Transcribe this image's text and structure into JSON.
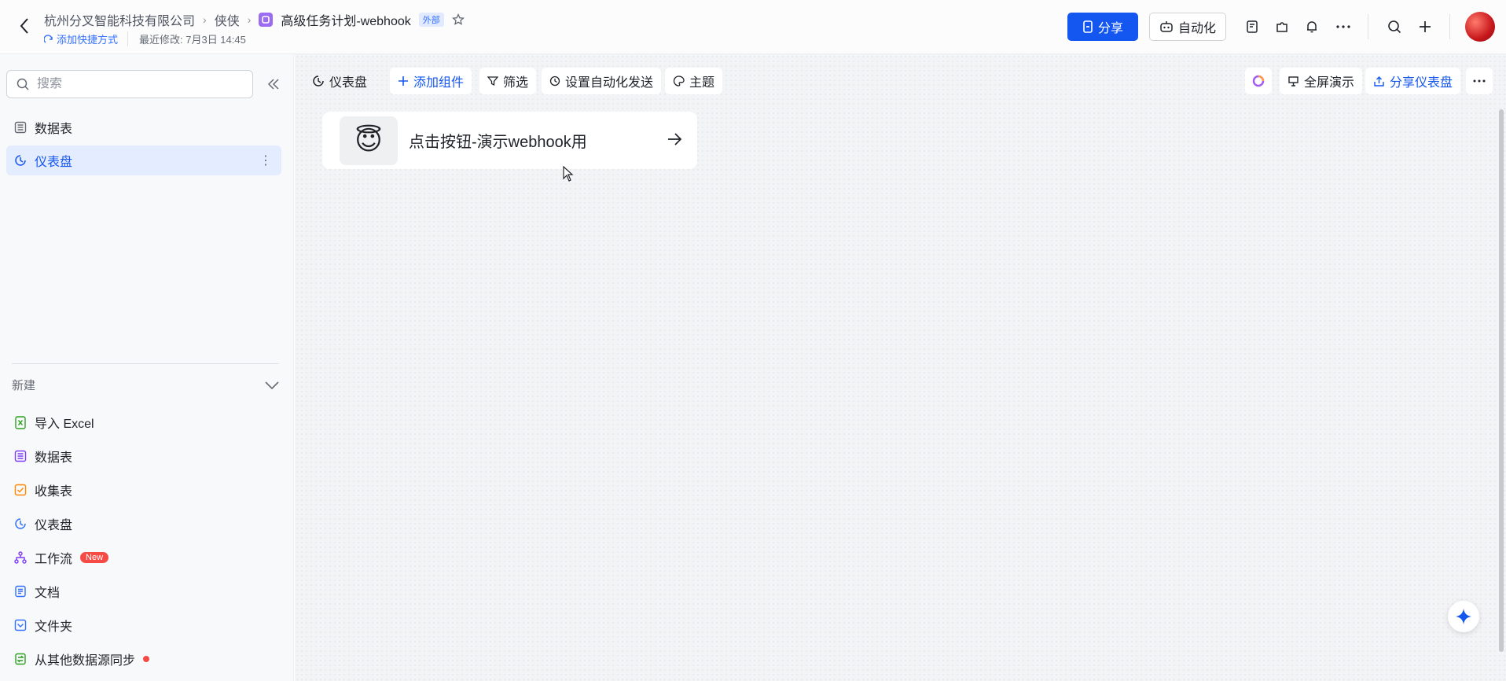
{
  "header": {
    "breadcrumb": [
      "杭州分叉智能科技有限公司",
      "侠侠"
    ],
    "doc_title": "高级任务计划-webhook",
    "external_badge": "外部",
    "add_shortcut": "添加快捷方式",
    "last_modified": "最近修改: 7月3日 14:45",
    "share_label": "分享",
    "automation_label": "自动化"
  },
  "sidebar": {
    "search_placeholder": "搜索",
    "items": [
      {
        "label": "数据表",
        "icon": "table-icon"
      },
      {
        "label": "仪表盘",
        "icon": "dashboard-icon",
        "active": true
      }
    ],
    "new_header": "新建",
    "new_items": [
      {
        "label": "导入 Excel",
        "icon": "excel-icon",
        "color": "#2ea121"
      },
      {
        "label": "数据表",
        "icon": "table-icon",
        "color": "#7f3bf5"
      },
      {
        "label": "收集表",
        "icon": "form-icon",
        "color": "#ff8800"
      },
      {
        "label": "仪表盘",
        "icon": "dashboard-icon",
        "color": "#3370ff"
      },
      {
        "label": "工作流",
        "icon": "workflow-icon",
        "color": "#7f3bf5",
        "badge": "New"
      },
      {
        "label": "文档",
        "icon": "doc-icon",
        "color": "#3370ff"
      },
      {
        "label": "文件夹",
        "icon": "folder-icon",
        "color": "#3370ff"
      },
      {
        "label": "从其他数据源同步",
        "icon": "sync-icon",
        "color": "#2ea121",
        "dot": true
      }
    ]
  },
  "toolbar": {
    "dashboard_label": "仪表盘",
    "add_widget": "添加组件",
    "filter": "筛选",
    "auto_send": "设置自动化发送",
    "theme": "主题",
    "fullscreen": "全屏演示",
    "share_dashboard": "分享仪表盘"
  },
  "card": {
    "emoji": "😇",
    "label": "点击按钮-演示webhook用"
  },
  "colors": {
    "accent": "#1456f0",
    "active_bg": "#e4ecff"
  }
}
